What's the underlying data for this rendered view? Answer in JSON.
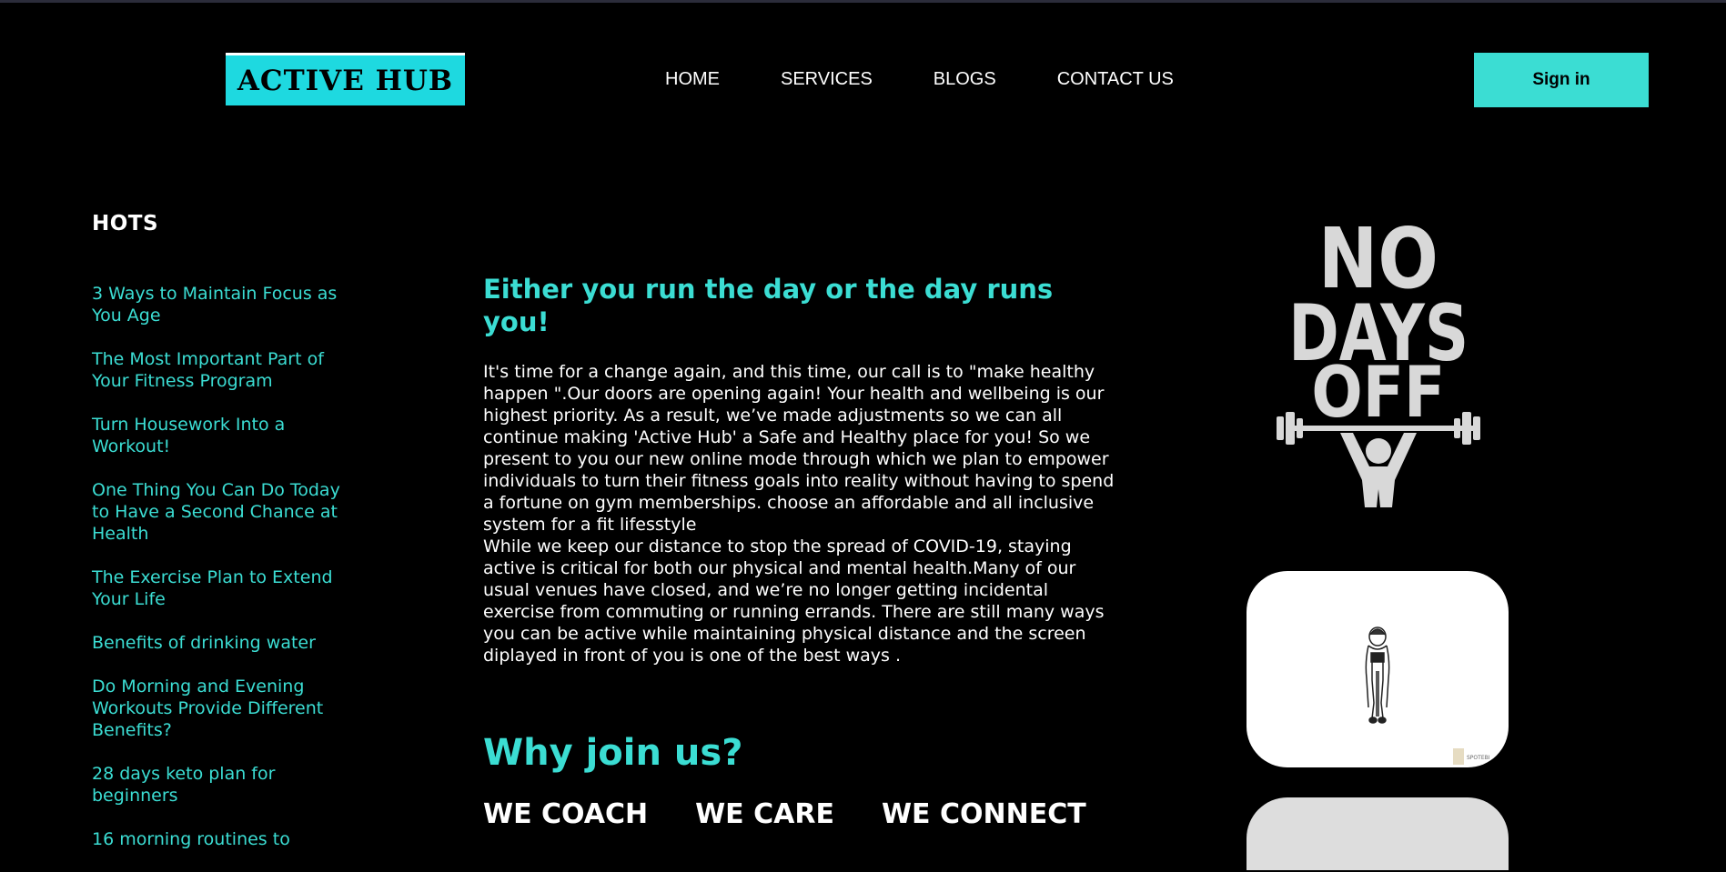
{
  "brand": {
    "logo_text": "ACTIVE HUB"
  },
  "nav": {
    "home": "HOME",
    "services": "SERVICES",
    "blogs": "BLOGS",
    "contact": "CONTACT US",
    "signin": "Sign in"
  },
  "sidebar": {
    "title": "HOTS",
    "items": [
      "3 Ways to Maintain Focus as You Age",
      "The Most Important Part of Your Fitness Program",
      "Turn Housework Into a Workout!",
      "One Thing You Can Do Today to Have a Second Chance at Health",
      "The Exercise Plan to Extend Your Life",
      "Benefits of drinking water",
      "Do Morning and Evening Workouts Provide Different Benefits?",
      "28 days keto plan for beginners",
      "16 morning routines to"
    ]
  },
  "main": {
    "headline": "Either you run the day or the day runs you!",
    "paragraph1": "It's time for a change again, and this time, our call is to \"make healthy happen \".Our doors are opening again! Your health and wellbeing is our highest priority. As a result, we’ve made adjustments so we can all continue making 'Active Hub' a Safe and Healthy place for you! So we present to you our new online mode through which we plan to empower individuals to turn their fitness goals into reality without having to spend a fortune on gym memberships. choose an affordable and all inclusive system for a fit lifesstyle",
    "paragraph2": "While we keep our distance to stop the spread of COVID-19, staying active is critical for both our physical and mental health.Many of our usual venues have closed, and we’re no longer getting incidental exercise from commuting or running errands. There are still many ways you can be active while maintaining physical distance and the screen diplayed in front of you is one of the best ways .",
    "why_title": "Why join us?",
    "pillars": [
      "WE COACH",
      "WE CARE",
      "WE CONNECT"
    ]
  },
  "aside": {
    "poster_lines": [
      "NO",
      "DAYS",
      "OFF"
    ],
    "card_watermark": "SPOTEBI"
  },
  "colors": {
    "accent": "#3bddd3",
    "logo_bg": "#1ed9e0",
    "background": "#000000"
  },
  "icons": {
    "poster": "barbell-figure-icon",
    "card": "woman-stretching-icon"
  }
}
